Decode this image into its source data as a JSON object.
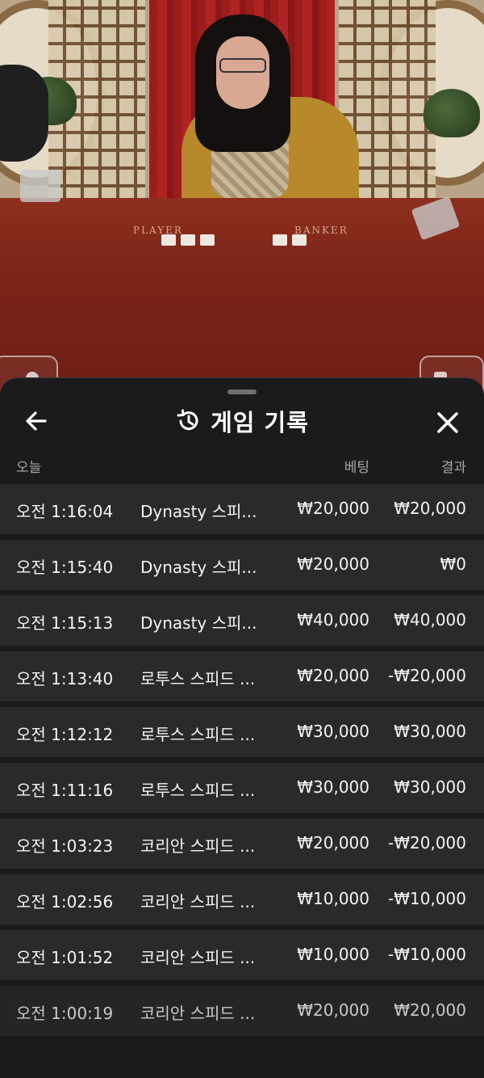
{
  "video": {
    "table_labels": {
      "player": "PLAYER",
      "banker": "BANKER"
    }
  },
  "sheet": {
    "title": "게임 기록",
    "icons": {
      "back": "arrow-left-icon",
      "history": "history-icon",
      "close": "close-icon"
    },
    "columns": {
      "date": "오늘",
      "bet": "베팅",
      "result": "결과"
    },
    "rows": [
      {
        "time": "오전 1:16:04",
        "game": "Dynasty 스피...",
        "bet": "₩20,000",
        "result": "₩20,000"
      },
      {
        "time": "오전 1:15:40",
        "game": "Dynasty 스피...",
        "bet": "₩20,000",
        "result": "₩0"
      },
      {
        "time": "오전 1:15:13",
        "game": "Dynasty 스피...",
        "bet": "₩40,000",
        "result": "₩40,000"
      },
      {
        "time": "오전 1:13:40",
        "game": "로투스 스피드 ...",
        "bet": "₩20,000",
        "result": "-₩20,000"
      },
      {
        "time": "오전 1:12:12",
        "game": "로투스 스피드 ...",
        "bet": "₩30,000",
        "result": "₩30,000"
      },
      {
        "time": "오전 1:11:16",
        "game": "로투스 스피드 ...",
        "bet": "₩30,000",
        "result": "₩30,000"
      },
      {
        "time": "오전 1:03:23",
        "game": "코리안 스피드 ...",
        "bet": "₩20,000",
        "result": "-₩20,000"
      },
      {
        "time": "오전 1:02:56",
        "game": "코리안 스피드 ...",
        "bet": "₩10,000",
        "result": "-₩10,000"
      },
      {
        "time": "오전 1:01:52",
        "game": "코리안 스피드 ...",
        "bet": "₩10,000",
        "result": "-₩10,000"
      },
      {
        "time": "오전 1:00:19",
        "game": "코리안 스피드 ...",
        "bet": "₩20,000",
        "result": "₩20,000"
      }
    ]
  }
}
